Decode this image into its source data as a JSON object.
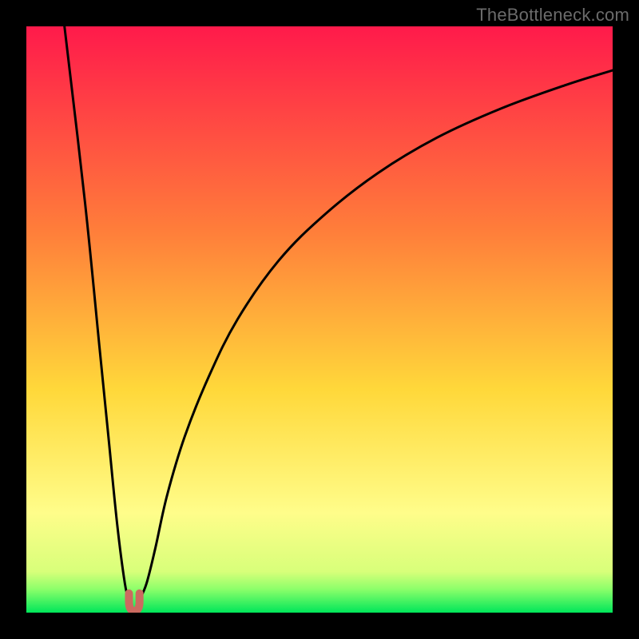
{
  "attribution": "TheBottleneck.com",
  "colors": {
    "frame": "#000000",
    "gradient_top": "#ff1a4b",
    "gradient_mid_upper": "#ff7e3a",
    "gradient_mid": "#ffd83a",
    "gradient_low": "#fffd8a",
    "gradient_base": "#00e65a",
    "curve": "#000000",
    "marker_fill": "#cb6a60",
    "marker_stroke": "#8a3e37"
  },
  "chart_data": {
    "type": "line",
    "title": "",
    "xlabel": "",
    "ylabel": "",
    "xlim": [
      0,
      100
    ],
    "ylim": [
      0,
      100
    ],
    "series": [
      {
        "name": "left-branch",
        "x": [
          6.5,
          10,
          12.5,
          14,
          15.5,
          16.8,
          17.5
        ],
        "y": [
          100,
          70,
          45,
          30,
          15,
          5,
          2.2
        ]
      },
      {
        "name": "right-branch",
        "x": [
          19.3,
          20.5,
          22,
          24,
          27,
          31,
          36,
          43,
          51,
          60,
          70,
          81,
          92,
          100
        ],
        "y": [
          2.2,
          5,
          11,
          20,
          30,
          40,
          50,
          60,
          68,
          75,
          81,
          86,
          90,
          92.5
        ]
      }
    ],
    "markers": [
      {
        "name": "notch-left",
        "x": 17.5,
        "y": 2.2
      },
      {
        "name": "notch-right",
        "x": 19.3,
        "y": 2.2
      }
    ],
    "gradient_stops": [
      {
        "pct": 0,
        "color": "#ff1a4b"
      },
      {
        "pct": 35,
        "color": "#ff7e3a"
      },
      {
        "pct": 62,
        "color": "#ffd83a"
      },
      {
        "pct": 83,
        "color": "#fffd8a"
      },
      {
        "pct": 93,
        "color": "#d8ff7a"
      },
      {
        "pct": 96,
        "color": "#8cff6a"
      },
      {
        "pct": 100,
        "color": "#00e65a"
      }
    ]
  }
}
